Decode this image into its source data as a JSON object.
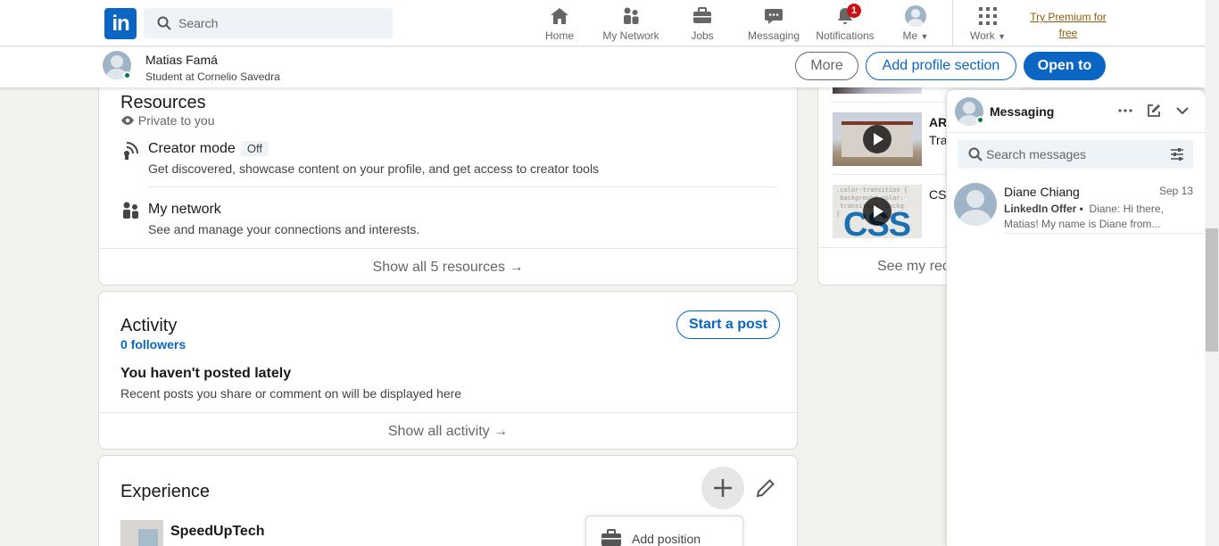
{
  "nav": {
    "search_placeholder": "Search",
    "items": [
      {
        "label": "Home"
      },
      {
        "label": "My Network"
      },
      {
        "label": "Jobs"
      },
      {
        "label": "Messaging"
      },
      {
        "label": "Notifications",
        "badge": "1"
      },
      {
        "label": "Me"
      },
      {
        "label": "Work"
      }
    ],
    "premium": "Try Premium for free"
  },
  "profile_bar": {
    "name": "Matias Famá",
    "headline": "Student at Cornelio Savedra",
    "more_label": "More",
    "add_section_label": "Add profile section",
    "open_to_label": "Open to"
  },
  "resources": {
    "title": "Resources",
    "privacy": "Private to you",
    "creator_mode": {
      "title": "Creator mode",
      "status": "Off",
      "desc": "Get discovered, showcase content on your profile, and get access to creator tools"
    },
    "my_network": {
      "title": "My network",
      "desc": "See and manage your connections and interests."
    },
    "show_all": "Show all 5 resources →"
  },
  "activity": {
    "title": "Activity",
    "followers": "0 followers",
    "start_post": "Start a post",
    "empty_title": "You haven't posted lately",
    "empty_desc": "Recent posts you share or comment on will be displayed here",
    "show_all": "Show all activity →"
  },
  "experience": {
    "title": "Experience",
    "company": "SpeedUpTech",
    "add_position": "Add position"
  },
  "right_card": {
    "item2_line1": "ARC",
    "item2_line2": "Tra",
    "item3_line1": "CSS",
    "show_all": "See my rec"
  },
  "messaging": {
    "title": "Messaging",
    "search_placeholder": "Search messages",
    "conversations": [
      {
        "name": "Diane Chiang",
        "date": "Sep 13",
        "tag": "LinkedIn Offer •",
        "preview": "Diane: Hi there, Matias! My name is Diane from..."
      }
    ]
  },
  "colors": {
    "brand": "#0a66c2",
    "notification_badge": "#cc1016",
    "online": "#057642",
    "premium": "#915907"
  }
}
